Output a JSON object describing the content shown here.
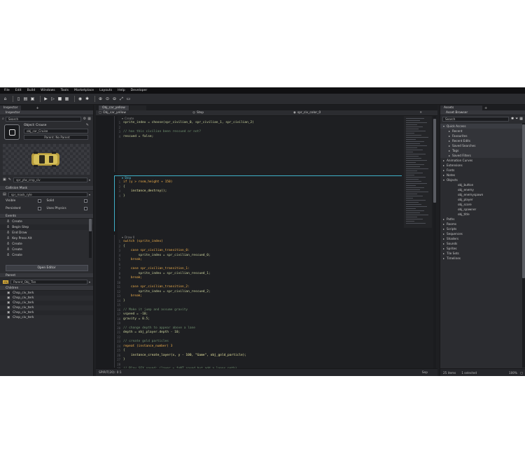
{
  "menu": [
    "File",
    "Edit",
    "Build",
    "Windows",
    "Tools",
    "Marketplace",
    "Layouts",
    "Help",
    "Developer"
  ],
  "toolbar_icons": [
    "home-icon",
    "new-icon",
    "open-icon",
    "save-icon",
    "play-icon",
    "debug-icon",
    "stop-icon",
    "clean-icon",
    "target-icon",
    "settings-icon",
    "zoom-in-icon",
    "zoom-reset-icon",
    "zoom-out-icon",
    "fullscreen-icon",
    "window-icon"
  ],
  "left": {
    "tabs": [
      "Inspector"
    ],
    "header": "Inspector",
    "search_placeholder": "Search",
    "object_label": "Object: Crouse",
    "name_field": "obj_car_Cruise",
    "parent_label": "Parent: No Parent",
    "sprite_field": "spr_ylw_crsp_civ",
    "collision_label": "Collision Mask",
    "mask_field": "spr_mask_ryle",
    "flags": [
      "Visible",
      "Solid",
      "Persistent",
      "Uses Physics"
    ],
    "events_header": "Events",
    "events": [
      "Create",
      "Begin Step",
      "End Draw",
      "Key Press Alt",
      "Create",
      "Create",
      "Create"
    ],
    "open_editor": "Open Editor",
    "parent_header": "Parent",
    "parent_field": "Parent_Obj_Tkn",
    "children_header": "Children",
    "children": [
      "Chsp_civ_terk",
      "Chsp_civ_terk",
      "Chsp_civ_terk",
      "Chsp_civ_terk",
      "Chsp_civ_terk",
      "Chsp_civ_terk"
    ]
  },
  "editor": {
    "tabs": [
      "Obj_car_yellow",
      ""
    ],
    "subtabs": [
      "Obj_car_yellow",
      "Step",
      "spr_civ_color_0"
    ],
    "footer_left": "SPIRIT(20): 0:1",
    "footer_right": "Sep",
    "block1_label": "Create",
    "block1": [
      [
        "var",
        "sprite_index = choose(spr_civilian_0, spr_civilian_1, spr_civilian_2)"
      ],
      [
        "cm",
        ""
      ],
      [
        "cm",
        "// has this civilian been rescued or not?"
      ],
      [
        "var",
        "rescued = false;"
      ]
    ],
    "block2_label": "Step",
    "block2": [
      [
        "kw",
        "if (y > room_height + 150)"
      ],
      [
        "var",
        "{"
      ],
      [
        "fn",
        "    instance_destroy();"
      ],
      [
        "var",
        "}"
      ]
    ],
    "block3_label": "Draw 0",
    "block3": [
      [
        "kw",
        "switch (sprite_index)"
      ],
      [
        "var",
        "{"
      ],
      [
        "kw",
        "    case spr_civilian_transition_0:"
      ],
      [
        "var",
        "        sprite_index = spr_civilian_rescued_0;"
      ],
      [
        "kw",
        "    break;"
      ],
      [
        "var",
        ""
      ],
      [
        "kw",
        "    case spr_civilian_transition_1:"
      ],
      [
        "var",
        "        sprite_index = spr_civilian_rescued_1;"
      ],
      [
        "kw",
        "    break;"
      ],
      [
        "var",
        ""
      ],
      [
        "kw",
        "    case spr_civilian_transition_2:"
      ],
      [
        "var",
        "        sprite_index = spr_civilian_rescued_2;"
      ],
      [
        "kw",
        "    break;"
      ],
      [
        "var",
        "}"
      ],
      [
        "var",
        ""
      ],
      [
        "cm",
        "// Make it jump and assume gravity"
      ],
      [
        "var",
        "vspeed = -10;"
      ],
      [
        "var",
        "gravity = 0.5;"
      ],
      [
        "var",
        ""
      ],
      [
        "cm",
        "// change depth to appear above a lane"
      ],
      [
        "var",
        "depth = obj_player.depth - 10;"
      ],
      [
        "var",
        ""
      ],
      [
        "cm",
        "// create gold particles"
      ],
      [
        "kw",
        "repeat (instance_number) 3"
      ],
      [
        "var",
        "{"
      ],
      [
        "fn",
        "    instance_create_layer(x, y - 100, \"Game\", obj_gold_particle);"
      ],
      [
        "var",
        "}"
      ],
      [
        "var",
        ""
      ],
      [
        "cm",
        "// Play SFX sound; (layer + fxNT sound but add a loops path)"
      ],
      [
        "fn",
        "snd = audio_play_sound(snd_player_fall, 0, 0);"
      ]
    ]
  },
  "right": {
    "tabs": [
      "Assets"
    ],
    "header": "Asset Browser",
    "search_placeholder": "Search",
    "tree": [
      {
        "label": "Quick Access",
        "depth": 0,
        "arrow": "down",
        "selected": true
      },
      {
        "label": "Recent",
        "depth": 1,
        "arrow": "right"
      },
      {
        "label": "Favourites",
        "depth": 1,
        "arrow": "right"
      },
      {
        "label": "Recent Edits",
        "depth": 1,
        "arrow": "right"
      },
      {
        "label": "Saved Searches",
        "depth": 1,
        "arrow": "right"
      },
      {
        "label": "Tags",
        "depth": 1,
        "arrow": "right"
      },
      {
        "label": "Saved Filters",
        "depth": 1,
        "arrow": "right"
      },
      {
        "label": "Animation Curves",
        "depth": 0,
        "arrow": "right"
      },
      {
        "label": "Extensions",
        "depth": 0,
        "arrow": "right"
      },
      {
        "label": "Fonts",
        "depth": 0,
        "arrow": "right"
      },
      {
        "label": "Notes",
        "depth": 0,
        "arrow": "right"
      },
      {
        "label": "Objects",
        "depth": 0,
        "arrow": "down"
      },
      {
        "label": "obj_button",
        "depth": 2,
        "arrow": ""
      },
      {
        "label": "obj_enemy",
        "depth": 2,
        "arrow": ""
      },
      {
        "label": "obj_enemyspawn",
        "depth": 2,
        "arrow": ""
      },
      {
        "label": "obj_player",
        "depth": 2,
        "arrow": ""
      },
      {
        "label": "obj_score",
        "depth": 2,
        "arrow": ""
      },
      {
        "label": "obj_spawner",
        "depth": 2,
        "arrow": ""
      },
      {
        "label": "obj_title",
        "depth": 2,
        "arrow": ""
      },
      {
        "label": "Paths",
        "depth": 0,
        "arrow": "right"
      },
      {
        "label": "Rooms",
        "depth": 0,
        "arrow": "right"
      },
      {
        "label": "Scripts",
        "depth": 0,
        "arrow": "right"
      },
      {
        "label": "Sequences",
        "depth": 0,
        "arrow": "right"
      },
      {
        "label": "Shaders",
        "depth": 0,
        "arrow": "right"
      },
      {
        "label": "Sounds",
        "depth": 0,
        "arrow": "right"
      },
      {
        "label": "Sprites",
        "depth": 0,
        "arrow": "right"
      },
      {
        "label": "Tile Sets",
        "depth": 0,
        "arrow": "right"
      },
      {
        "label": "Timelines",
        "depth": 0,
        "arrow": "right"
      }
    ],
    "footer_count": "25 items",
    "footer_selected": "1 selected",
    "footer_zoom": "100%"
  }
}
